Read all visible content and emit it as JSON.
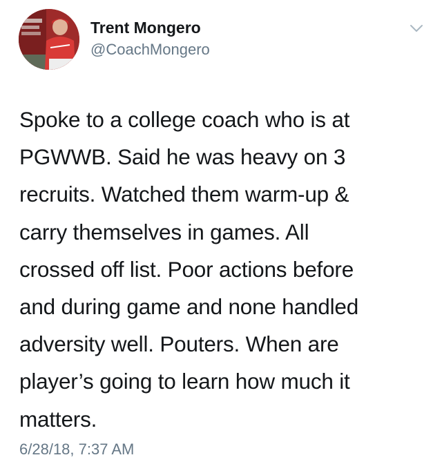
{
  "author": {
    "display_name": "Trent Mongero",
    "handle": "@CoachMongero",
    "avatar_icon": "avatar-photo"
  },
  "menu": {
    "icon": "chevron-down-icon"
  },
  "tweet": {
    "text": "Spoke to a college coach who is at\nPGWWB. Said he was heavy on 3\nrecruits. Watched them warm-up &\ncarry themselves in games. All\ncrossed off list. Poor actions before\nand during game and none handled\nadversity well. Pouters. When are\nplayer’s going to learn how much it\nmatters.",
    "timestamp": "6/28/18, 7:37 AM"
  },
  "colors": {
    "primary_text": "#14171a",
    "secondary_text": "#657786",
    "background": "#ffffff"
  }
}
